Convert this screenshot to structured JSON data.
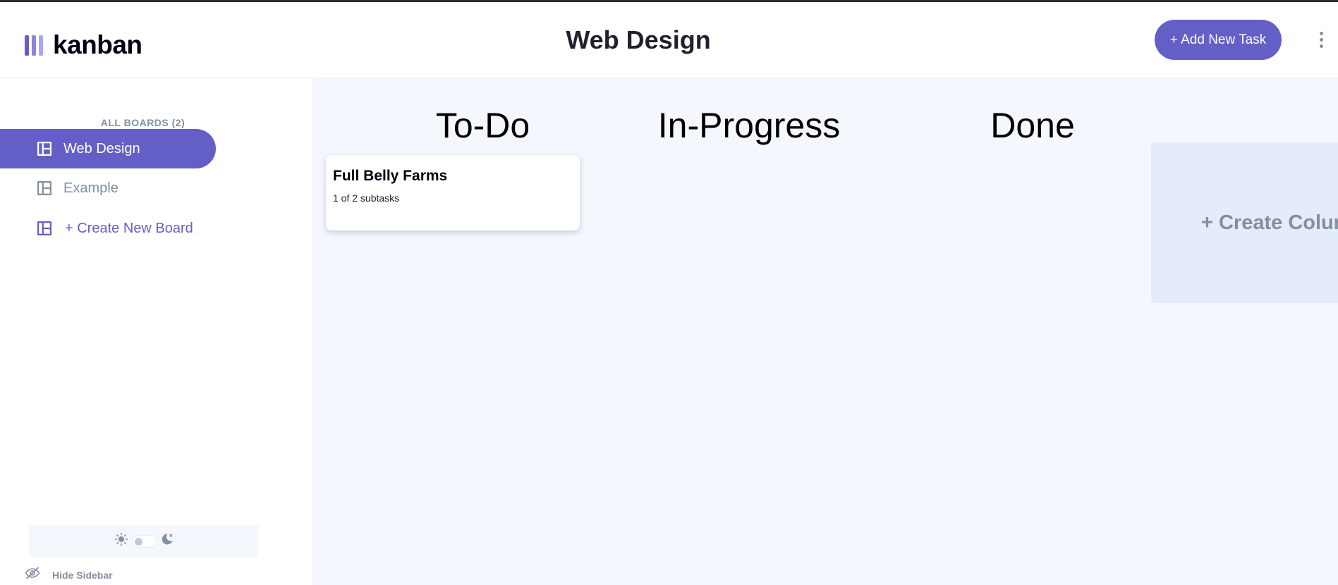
{
  "app": {
    "logo_text": "kanban",
    "logo_bar_colors": [
      "#635fc7",
      "#8a86d9",
      "#a8a4ff"
    ],
    "accent_color": "#635fc7"
  },
  "header": {
    "board_title": "Web Design",
    "add_task_label": "+ Add New Task",
    "menu_icon": "vertical-ellipsis-icon"
  },
  "sidebar": {
    "heading": "ALL BOARDS (2)",
    "boards": [
      {
        "label": "Web Design",
        "icon": "board-icon",
        "active": true
      },
      {
        "label": "Example",
        "icon": "board-icon",
        "active": false
      }
    ],
    "create_board_label": "+ Create New Board",
    "theme": {
      "light_icon": "sun-icon",
      "dark_icon": "moon-icon",
      "mode": "light"
    },
    "hide_label": "Hide Sidebar",
    "hide_icon": "eye-slash-icon"
  },
  "board": {
    "columns": [
      {
        "name": "To-Do"
      },
      {
        "name": "In-Progress"
      },
      {
        "name": "Done"
      }
    ],
    "tasks": [
      {
        "title": "Full Belly Farms",
        "subtasks": "1 of 2 subtasks"
      }
    ],
    "new_column_label": "+ Create Column"
  }
}
